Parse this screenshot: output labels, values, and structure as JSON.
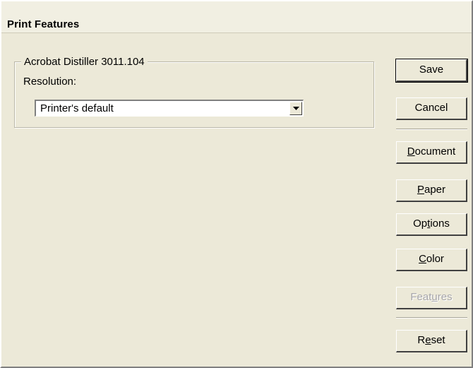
{
  "window": {
    "title": "Print Features"
  },
  "group": {
    "legend": "Acrobat Distiller 3011.104",
    "resolution_label": "Resolution:",
    "resolution_value": "Printer's default"
  },
  "buttons": {
    "save": "Save",
    "cancel": "Cancel",
    "document": {
      "pre": "",
      "key": "D",
      "post": "ocument"
    },
    "paper": {
      "pre": "",
      "key": "P",
      "post": "aper"
    },
    "options": {
      "pre": "Op",
      "key": "t",
      "post": "ions"
    },
    "color": {
      "pre": "",
      "key": "C",
      "post": "olor"
    },
    "features": {
      "pre": "Feat",
      "key": "u",
      "post": "res"
    },
    "reset": {
      "pre": "R",
      "key": "e",
      "post": "set"
    }
  },
  "icons": {
    "dropdown_arrow": "triangle-down-icon"
  }
}
